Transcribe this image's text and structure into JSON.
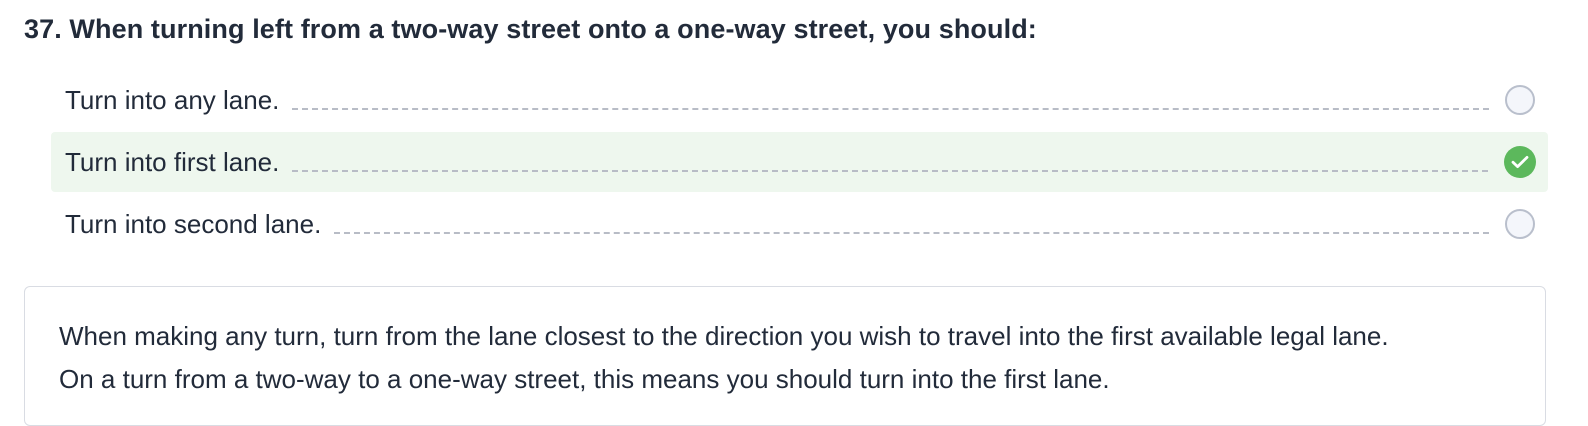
{
  "question": {
    "text": "37. When turning left from a two-way street onto a one-way street, you should:"
  },
  "answers": [
    {
      "label": "Turn into any lane.",
      "state": "unselected"
    },
    {
      "label": "Turn into first lane.",
      "state": "correct"
    },
    {
      "label": "Turn into second lane.",
      "state": "unselected"
    }
  ],
  "explanation": {
    "line1": "When making any turn, turn from the lane closest to the direction you wish to travel into the first available legal lane.",
    "line2": "On a turn from a two-way to a one-way street, this means you should turn into the first lane."
  },
  "colors": {
    "correct_background": "#eef7ee",
    "correct_check": "#5cb85c",
    "radio_border": "#b9bfcc",
    "text": "#222b3a"
  },
  "icons": {
    "correct": "check-circle-icon",
    "unselected": "radio-empty-icon"
  }
}
